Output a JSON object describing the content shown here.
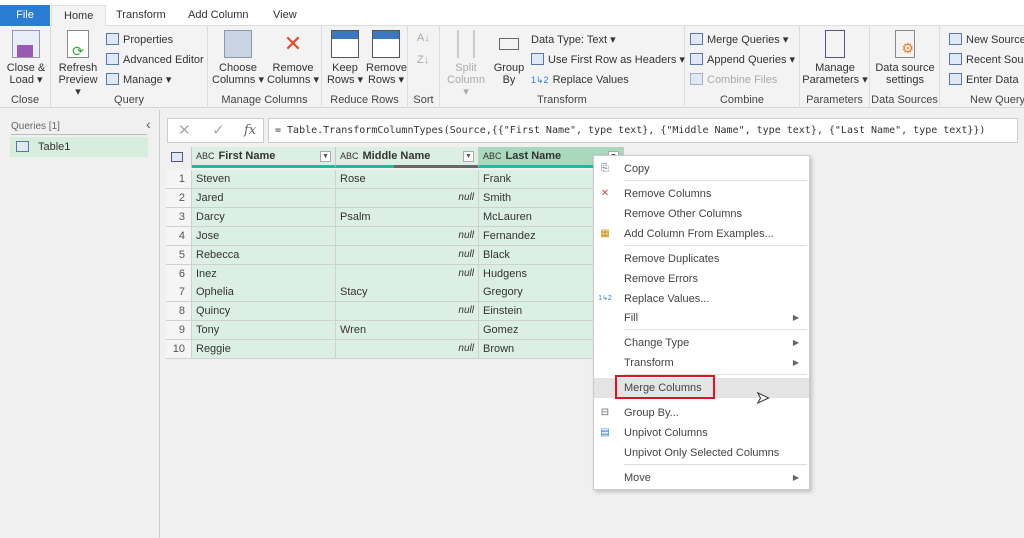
{
  "tabs": [
    "File",
    "Home",
    "Transform",
    "Add Column",
    "View"
  ],
  "ribbon": {
    "close": {
      "close_load": "Close &",
      "close_load2": "Load",
      "label": "Close"
    },
    "query": {
      "refresh": "Refresh",
      "refresh2": "Preview",
      "properties": "Properties",
      "advanced_editor": "Advanced Editor",
      "manage": "Manage",
      "label": "Query"
    },
    "manage_columns": {
      "choose": "Choose",
      "choose2": "Columns",
      "remove": "Remove",
      "remove2": "Columns",
      "label": "Manage Columns"
    },
    "reduce_rows": {
      "keep": "Keep",
      "keep2": "Rows",
      "remove": "Remove",
      "remove2": "Rows",
      "label": "Reduce Rows"
    },
    "sort": {
      "label": "Sort"
    },
    "transform": {
      "split": "Split",
      "split2": "Column",
      "group": "Group",
      "group2": "By",
      "data_type": "Data Type: Text",
      "first_row": "Use First Row as Headers",
      "replace": "Replace Values",
      "label": "Transform"
    },
    "combine": {
      "merge": "Merge Queries",
      "append": "Append Queries",
      "combine_files": "Combine Files",
      "label": "Combine"
    },
    "parameters": {
      "manage": "Manage",
      "manage2": "Parameters",
      "label": "Parameters"
    },
    "data_sources": {
      "settings": "Data source",
      "settings2": "settings",
      "label": "Data Sources"
    },
    "new_query": {
      "new_source": "New Source",
      "recent": "Recent Sources",
      "enter": "Enter Data",
      "label": "New Query"
    }
  },
  "queries": {
    "title": "Queries [1]",
    "items": [
      "Table1"
    ]
  },
  "formula": "= Table.TransformColumnTypes(Source,{{\"First Name\", type text}, {\"Middle Name\", type text}, {\"Last Name\", type text}})",
  "table": {
    "type_label": "ABC",
    "columns": [
      "First Name",
      "Middle Name",
      "Last Name"
    ],
    "rows": [
      [
        "1",
        "Steven",
        "Rose",
        "Frank"
      ],
      [
        "2",
        "Jared",
        "null",
        "Smith"
      ],
      [
        "3",
        "Darcy",
        "Psalm",
        "McLauren"
      ],
      [
        "4",
        "Jose",
        "null",
        "Fernandez"
      ],
      [
        "5",
        "Rebecca",
        "null",
        "Black"
      ],
      [
        "6",
        "Inez",
        "null",
        "Hudgens"
      ],
      [
        "7",
        "Ophelia",
        "Stacy",
        "Gregory"
      ],
      [
        "8",
        "Quincy",
        "null",
        "Einstein"
      ],
      [
        "9",
        "Tony",
        "Wren",
        "Gomez"
      ],
      [
        "10",
        "Reggie",
        "null",
        "Brown"
      ]
    ]
  },
  "context_menu": {
    "items": [
      "Copy",
      "Remove Columns",
      "Remove Other Columns",
      "Add Column From Examples...",
      "Remove Duplicates",
      "Remove Errors",
      "Replace Values...",
      "Fill",
      "Change Type",
      "Transform",
      "Merge Columns",
      "Group By...",
      "Unpivot Columns",
      "Unpivot Only Selected Columns",
      "Move"
    ],
    "highlighted": "Merge Columns"
  },
  "colors": {
    "accent": "#2b7cd3",
    "selection": "#dcefe4",
    "highlight_box": "#e0141e"
  }
}
